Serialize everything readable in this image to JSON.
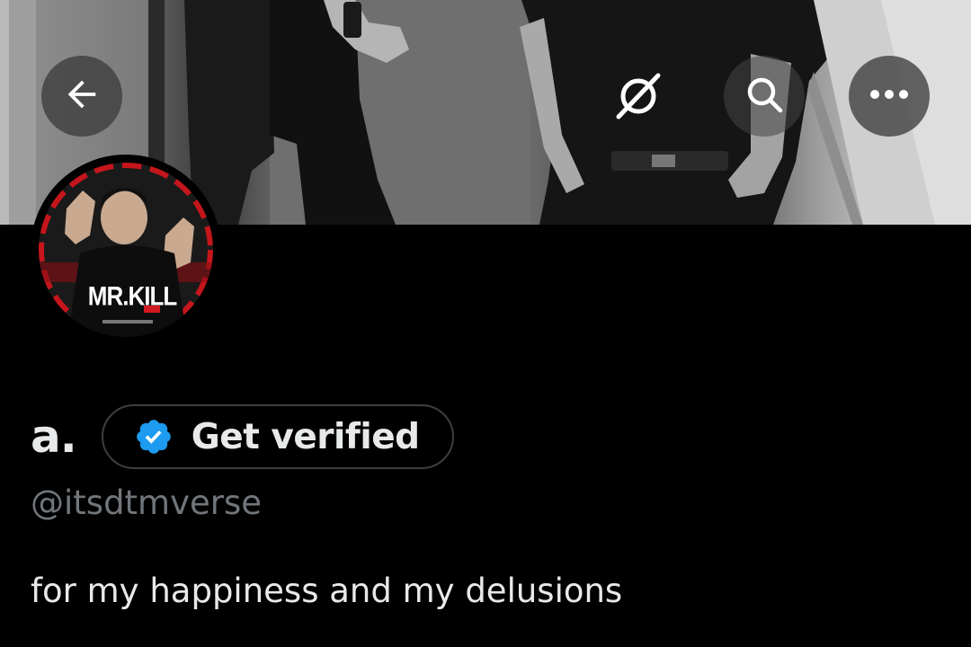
{
  "profile": {
    "display_name": "a.",
    "handle": "@itsdtmverse",
    "bio": "for my happiness and my delusions",
    "verify_button_label": "Get verified",
    "avatar_text": "MR.KILL"
  },
  "header": {
    "back_icon": "arrow-left-icon",
    "grok_icon": "grok-icon",
    "search_icon": "search-icon",
    "more_icon": "more-horizontal-icon"
  },
  "colors": {
    "background": "#000000",
    "text_primary": "#e7e9ea",
    "text_secondary": "#71767b",
    "verified_blue": "#1d9bf0",
    "button_border": "#3a3f44"
  }
}
